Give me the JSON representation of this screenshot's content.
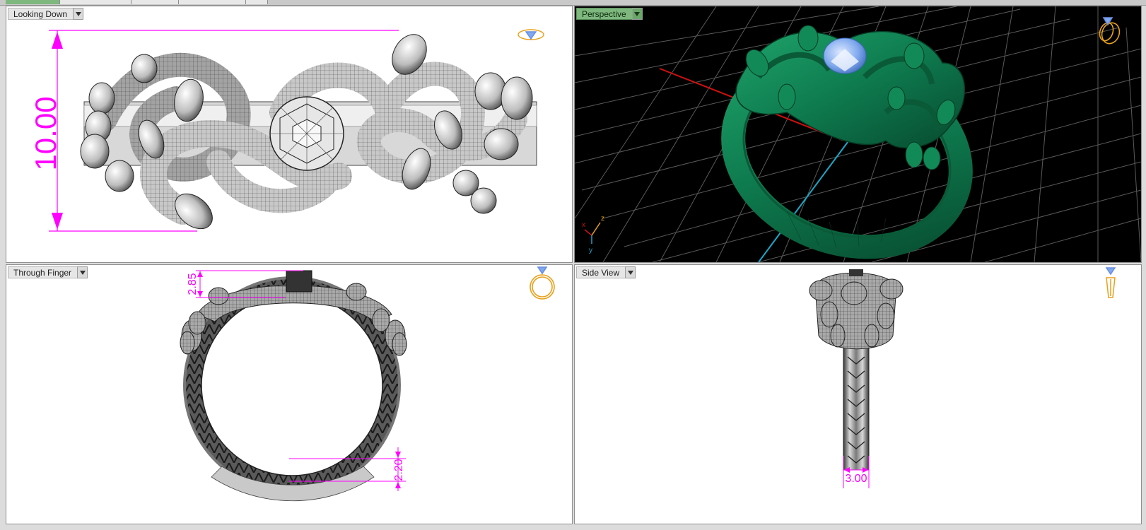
{
  "viewports": {
    "top_left": {
      "label": "Looking Down",
      "active": false,
      "dimension": "10.00"
    },
    "top_right": {
      "label": "Perspective",
      "active": true,
      "axes": {
        "x": "x",
        "y": "y",
        "z": "z"
      }
    },
    "bottom_left": {
      "label": "Through Finger",
      "active": false,
      "dimension_top": "2.85",
      "dimension_bottom": "2.20"
    },
    "bottom_right": {
      "label": "Side View",
      "active": false,
      "dimension": "3.00"
    }
  },
  "colors": {
    "dimension": "#ff00ff",
    "ring_green": "#0e7a4e",
    "gem_blue": "#7fa9ee",
    "nav_icon": "#e8a11a",
    "active_label": "#7fb87f",
    "grid": "#5a5a5a"
  },
  "icons": [
    "gem-nav-icon",
    "ring-nav-icon",
    "dropdown-arrow-icon"
  ]
}
